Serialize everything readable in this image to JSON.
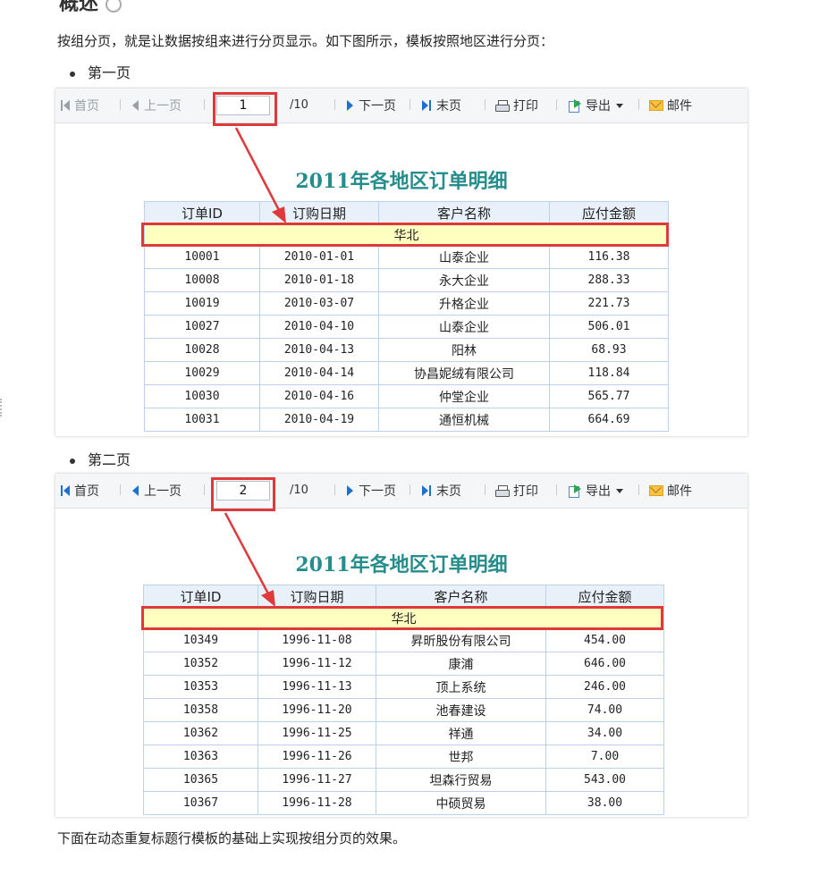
{
  "heading_fragment": "概述",
  "intro": "按组分页，就是让数据按组来进行分页显示。如下图所示，模板按照地区进行分页：",
  "outro": "下面在动态重复标题行模板的基础上实现按组分页的效果。",
  "toolbar": {
    "first": "首页",
    "prev": "上一页",
    "total": "/10",
    "next": "下一页",
    "last": "末页",
    "print": "打印",
    "export": "导出",
    "mail": "邮件"
  },
  "icons": [
    "first-page-icon",
    "prev-page-icon",
    "next-page-icon",
    "last-page-icon",
    "print-icon",
    "export-icon",
    "chevron-down-icon",
    "mail-icon"
  ],
  "colors": {
    "title": "#258d8b",
    "group_row": "#ffffc0",
    "header_row": "#e8f0f9",
    "highlight": "#e0393b"
  },
  "report": {
    "title": "2011年各地区订单明细",
    "columns": [
      "订单ID",
      "订购日期",
      "客户名称",
      "应付金额"
    ]
  },
  "pages": [
    {
      "bullet": "第一页",
      "page_value": "1",
      "group": "华北",
      "rows": [
        {
          "id": "10001",
          "date": "2010-01-01",
          "customer": "山泰企业",
          "amount": "116.38"
        },
        {
          "id": "10008",
          "date": "2010-01-18",
          "customer": "永大企业",
          "amount": "288.33"
        },
        {
          "id": "10019",
          "date": "2010-03-07",
          "customer": "升格企业",
          "amount": "221.73"
        },
        {
          "id": "10027",
          "date": "2010-04-10",
          "customer": "山泰企业",
          "amount": "506.01"
        },
        {
          "id": "10028",
          "date": "2010-04-13",
          "customer": "阳林",
          "amount": "68.93"
        },
        {
          "id": "10029",
          "date": "2010-04-14",
          "customer": "协昌妮绒有限公司",
          "amount": "118.84"
        },
        {
          "id": "10030",
          "date": "2010-04-16",
          "customer": "仲堂企业",
          "amount": "565.77"
        },
        {
          "id": "10031",
          "date": "2010-04-19",
          "customer": "通恒机械",
          "amount": "664.69"
        }
      ]
    },
    {
      "bullet": "第二页",
      "page_value": "2",
      "group": "华北",
      "rows": [
        {
          "id": "10349",
          "date": "1996-11-08",
          "customer": "昇昕股份有限公司",
          "amount": "454.00"
        },
        {
          "id": "10352",
          "date": "1996-11-12",
          "customer": "康浦",
          "amount": "646.00"
        },
        {
          "id": "10353",
          "date": "1996-11-13",
          "customer": "顶上系统",
          "amount": "246.00"
        },
        {
          "id": "10358",
          "date": "1996-11-20",
          "customer": "池春建设",
          "amount": "74.00"
        },
        {
          "id": "10362",
          "date": "1996-11-25",
          "customer": "祥通",
          "amount": "34.00"
        },
        {
          "id": "10363",
          "date": "1996-11-26",
          "customer": "世邦",
          "amount": "7.00"
        },
        {
          "id": "10365",
          "date": "1996-11-27",
          "customer": "坦森行贸易",
          "amount": "543.00"
        },
        {
          "id": "10367",
          "date": "1996-11-28",
          "customer": "中硕贸易",
          "amount": "38.00"
        }
      ]
    }
  ]
}
